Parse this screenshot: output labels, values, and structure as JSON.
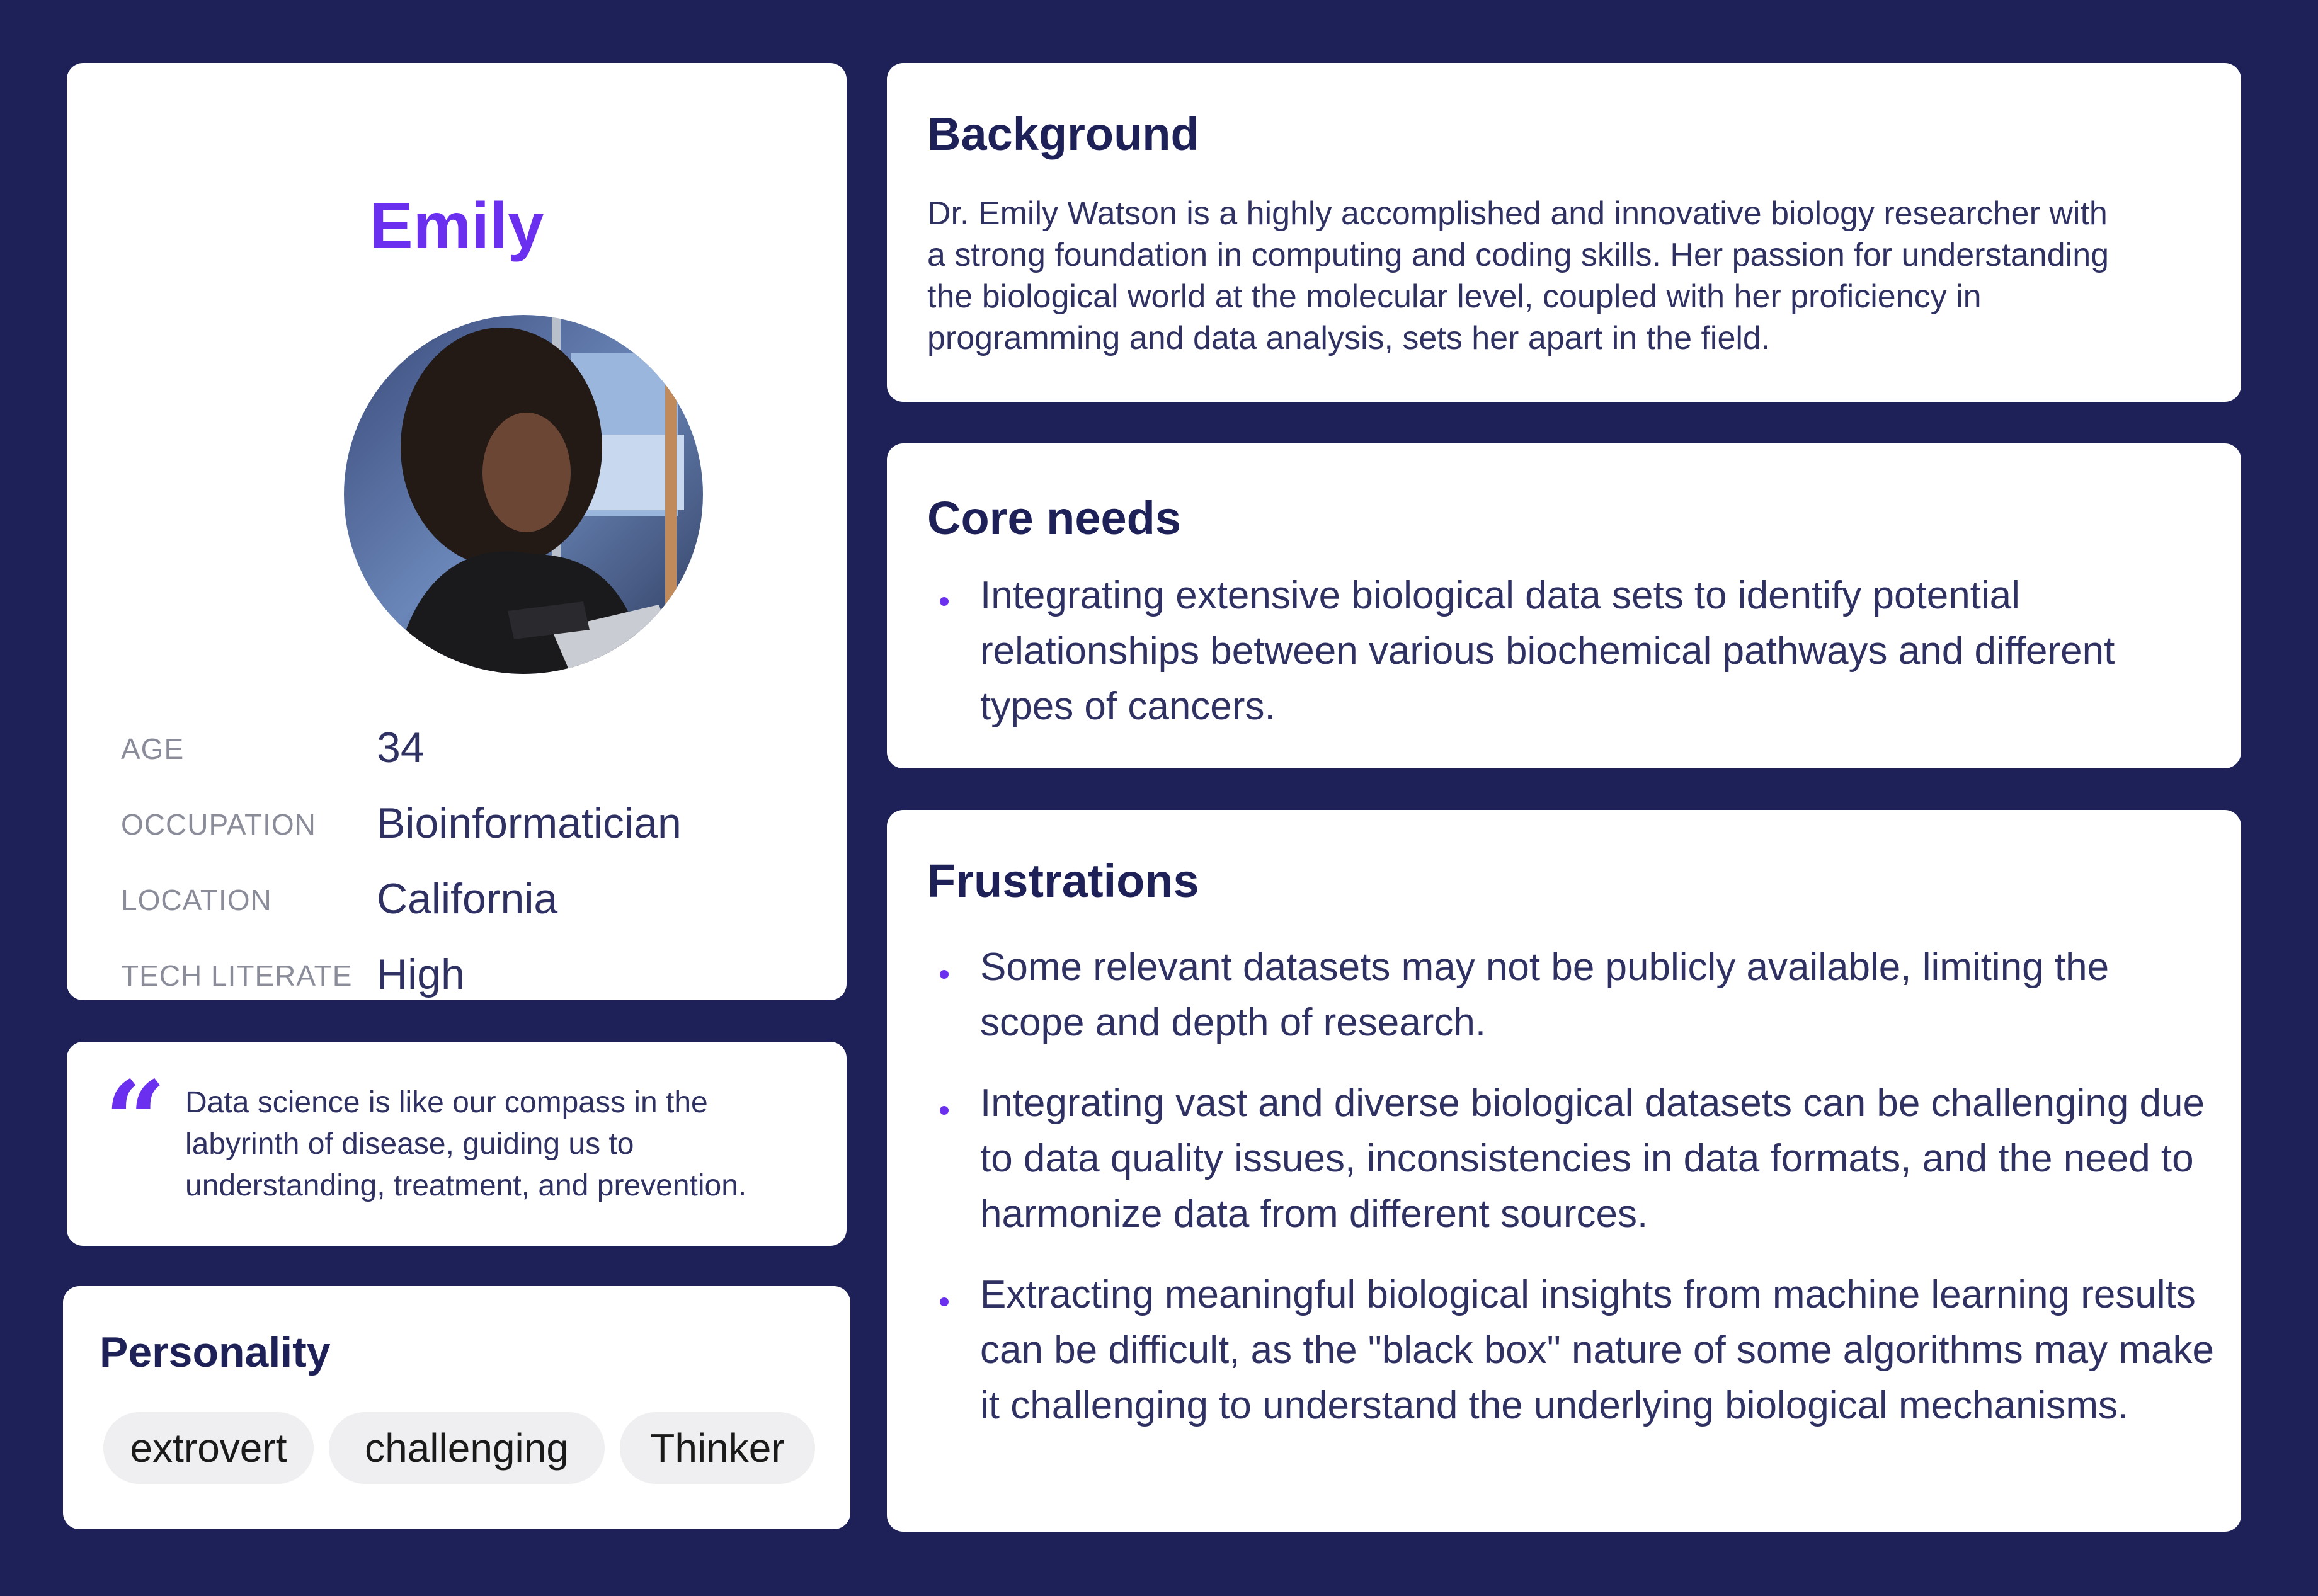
{
  "profile": {
    "name": "Emily",
    "attributes": [
      {
        "label": "AGE",
        "value": "34"
      },
      {
        "label": "OCCUPATION",
        "value": "Bioinformatician"
      },
      {
        "label": "LOCATION",
        "value": "California"
      },
      {
        "label": "TECH  LITERATE",
        "value": "High"
      }
    ]
  },
  "quote": {
    "mark": "“",
    "text": "Data science is like our compass in the labyrinth of disease, guiding us to understanding, treatment, and prevention."
  },
  "personality": {
    "title": "Personality",
    "tags": [
      "extrovert",
      "challenging",
      "Thinker"
    ]
  },
  "background": {
    "title": "Background",
    "text": "Dr. Emily Watson is a highly accomplished and innovative biology researcher with a strong foundation in computing and coding skills. Her passion for understanding the biological world at the molecular level, coupled with her proficiency in programming and data analysis, sets her apart in the field."
  },
  "core_needs": {
    "title": "Core needs",
    "items": [
      "Integrating extensive biological data sets to identify potential relationships between various biochemical pathways and different types of cancers."
    ]
  },
  "frustrations": {
    "title": "Frustrations",
    "items": [
      "Some relevant datasets may not be publicly available, limiting the scope and depth of research.",
      "Integrating vast and diverse biological datasets can be challenging due to data quality issues, inconsistencies in data formats, and the need to harmonize data from different sources.",
      "Extracting meaningful biological insights from machine learning results can be difficult, as the \"black box\" nature of some algorithms may make it challenging to understand the underlying biological mechanisms."
    ]
  },
  "colors": {
    "page_background": "#1e2157",
    "accent": "#6b2ff0",
    "card": "#ffffff",
    "tag_background": "#efeff1"
  }
}
